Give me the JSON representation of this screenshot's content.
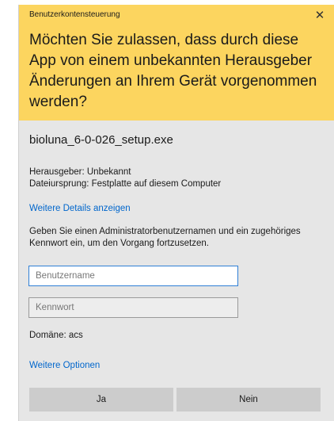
{
  "dialog": {
    "title": "Benutzerkontensteuerung",
    "close_symbol": "✕",
    "close_icon": "close-icon",
    "question": "Möchten Sie zulassen, dass durch diese App von einem unbekannten Herausgeber Änderungen an Ihrem Gerät vorgenommen werden?",
    "header_color": "#fcd55f"
  },
  "app": {
    "name": "bioluna_6-0-026_setup.exe",
    "publisher_line": "Herausgeber: Unbekannt",
    "origin_line": "Dateiursprung: Festplatte auf diesem Computer"
  },
  "links": {
    "more_details": "Weitere Details anzeigen",
    "more_options": "Weitere Optionen"
  },
  "credentials": {
    "instructions": "Geben Sie einen Administratorbenutzernamen und ein zugehöriges Kennwort ein, um den Vorgang fortzusetzen.",
    "username_value": "",
    "username_placeholder": "Benutzername",
    "password_value": "",
    "password_placeholder": "Kennwort",
    "domain": "Domäne: acs"
  },
  "buttons": {
    "yes": "Ja",
    "no": "Nein"
  }
}
